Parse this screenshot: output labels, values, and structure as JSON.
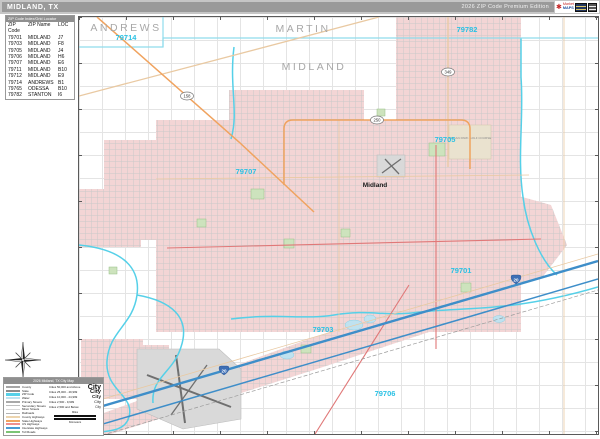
{
  "theme": {
    "titlestrip": "#c6c6c6",
    "titlebar": "#9a9a9a",
    "legendheader": "#8f8f8f",
    "pink": "#f3d5d5",
    "zipline": "#55d0e8",
    "countyline": "#8fdcec",
    "interstate": "#3e8ec9",
    "ushwy": "#e07878",
    "statehwy": "#f0a35f",
    "countyroad": "#e9c9a2",
    "park": "#cde3bd",
    "parkline": "#96bf86",
    "water": "#bfe2f0",
    "airport": "#d9d9d9",
    "runway": "#6f6f6f",
    "label_county": "#a8a8a8",
    "label_zip": "#2bc1e4"
  },
  "title_bar": {
    "title": "MIDLAND, TX",
    "edition": "2026 ZIP Code Premium Edition",
    "logo_star": "✱",
    "logo_top": "Market",
    "logo_bottom": "MAPS"
  },
  "zip_table": {
    "header": "ZIP Code Index/Grid Locator",
    "columns": {
      "zip": "ZIP Code",
      "name": "ZIP Name",
      "loc": "LOC"
    },
    "rows": [
      {
        "zip": "79701",
        "name": "MIDLAND",
        "loc": "J7"
      },
      {
        "zip": "79703",
        "name": "MIDLAND",
        "loc": "F8"
      },
      {
        "zip": "79705",
        "name": "MIDLAND",
        "loc": "J4"
      },
      {
        "zip": "79706",
        "name": "MIDLAND",
        "loc": "H6"
      },
      {
        "zip": "79707",
        "name": "MIDLAND",
        "loc": "E6"
      },
      {
        "zip": "79711",
        "name": "MIDLAND",
        "loc": "B10"
      },
      {
        "zip": "79712",
        "name": "MIDLAND",
        "loc": "E9"
      },
      {
        "zip": "79714",
        "name": "ANDREWS",
        "loc": "B1"
      },
      {
        "zip": "79765",
        "name": "ODESSA",
        "loc": "B10"
      },
      {
        "zip": "79782",
        "name": "STANTON",
        "loc": "I6"
      }
    ]
  },
  "map": {
    "county_labels": [
      {
        "text": "ANDREWS"
      },
      {
        "text": "MARTIN"
      },
      {
        "text": "MIDLAND"
      }
    ],
    "city_labels": [
      {
        "text": "Midland"
      }
    ],
    "zip_labels": [
      {
        "text": "79714"
      },
      {
        "text": "79782"
      },
      {
        "text": "79705"
      },
      {
        "text": "79707"
      },
      {
        "text": "79701"
      },
      {
        "text": "79703"
      },
      {
        "text": "79706"
      }
    ],
    "shields": [
      {
        "type": "interstate",
        "number": "20"
      },
      {
        "type": "interstate",
        "number": "20"
      },
      {
        "type": "loop",
        "number": "250"
      },
      {
        "type": "state",
        "number": "158"
      },
      {
        "type": "state",
        "number": "349"
      }
    ],
    "poi": {
      "hogan": "HOGAN PARK GOLF COURSE"
    }
  },
  "legend": {
    "header": "2026 Midland, TX City Map",
    "features": [
      {
        "label": "County",
        "color": "#a6a6a6"
      },
      {
        "label": "State",
        "color": "#8c8c8c"
      },
      {
        "label": "ZIP Code",
        "color": "#55d0e8"
      },
      {
        "label": "Water",
        "color": "#bfe2f0"
      },
      {
        "label": "Primary Streets",
        "color": "#a9a9a9"
      },
      {
        "label": "Secondary Streets",
        "color": "#bfbfbf"
      },
      {
        "label": "Minor Streets",
        "color": "#d9d9d9"
      },
      {
        "label": "Railroads",
        "color": "#b3b3b3"
      },
      {
        "label": "County Highways",
        "color": "#ecd4ae"
      },
      {
        "label": "State Highways",
        "color": "#f0a35f"
      },
      {
        "label": "US Highways",
        "color": "#ef8f8f"
      },
      {
        "label": "Interstate Highways",
        "color": "#4a9bd4"
      },
      {
        "label": "Toll Roads",
        "color": "#7cc576"
      }
    ],
    "cities": [
      {
        "label": "Cities 50,000 and Above",
        "sample": "City"
      },
      {
        "label": "Cities 25,000 - 49,999",
        "sample": "City"
      },
      {
        "label": "Cities 10,000 - 24,999",
        "sample": "City"
      },
      {
        "label": "Cities 2,500 - 9,999",
        "sample": "City"
      },
      {
        "label": "Cities 2,500 and Below",
        "sample": "City"
      }
    ],
    "scale": {
      "miles": "Miles",
      "kilometers": "Kilometers"
    }
  }
}
